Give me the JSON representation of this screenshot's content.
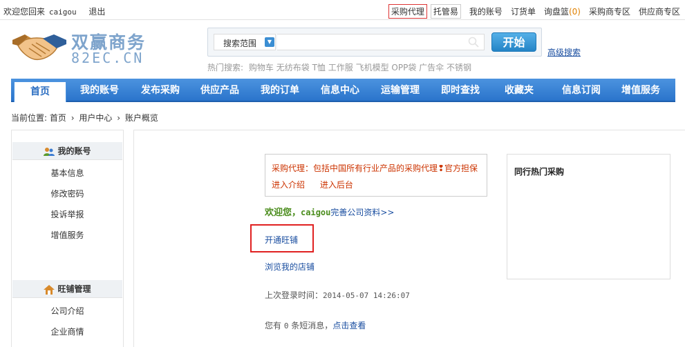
{
  "topbar": {
    "welcome": "欢迎您回来",
    "username": "caigou",
    "logout": "退出",
    "links": {
      "purchase_agent": "采购代理",
      "tuoguanyi": "托管易",
      "my_account": "我的账号",
      "order_list": "订货单",
      "inquiry_basket": "询盘篮",
      "inquiry_count": "(0)",
      "buyer_zone": "采购商专区",
      "supplier_zone": "供应商专区"
    }
  },
  "logo": {
    "name_cn": "双赢商务",
    "name_en": "82EC.CN"
  },
  "search": {
    "scope_label": "搜索范围",
    "value": "",
    "button": "开始",
    "advanced": "高级搜索",
    "hot_label": "热门搜索:",
    "hot_terms": [
      "购物车",
      "无纺布袋",
      "T恤",
      "工作服",
      "飞机模型",
      "OPP袋",
      "广告伞",
      "不锈钢"
    ]
  },
  "nav": {
    "items": [
      "首页",
      "我的账号",
      "发布采购",
      "供应产品",
      "我的订单",
      "信息中心",
      "运输管理",
      "即时查找",
      "收藏夹",
      "信息订阅",
      "增值服务"
    ]
  },
  "breadcrumb": {
    "label": "当前位置:",
    "path": [
      "首页",
      "用户中心",
      "账户概览"
    ],
    "separator": "›"
  },
  "sidebar": {
    "account": {
      "title": "我的账号",
      "items": [
        "基本信息",
        "修改密码",
        "投诉举报",
        "增值服务"
      ]
    },
    "shop": {
      "title": "旺铺管理",
      "items": [
        "公司介绍",
        "企业商情"
      ]
    }
  },
  "notice": {
    "text": "采购代理：包括中国所有行业产品的采购代理❢官方担保",
    "link_intro": "进入介绍",
    "link_backend": "进入后台"
  },
  "welcome": {
    "prefix": "欢迎您，",
    "username": "caigou",
    "link": "完善公司资料>>"
  },
  "shop_links": {
    "open": "开通旺铺",
    "browse": "浏览我的店铺"
  },
  "last_login": {
    "label": "上次登录时间：",
    "time": "2014-05-07 14:26:07"
  },
  "messages": {
    "prefix": "您有",
    "count": "0",
    "suffix": "条短消息，",
    "link": "点击查看"
  },
  "hot_purchase": {
    "title": "同行热门采购"
  }
}
